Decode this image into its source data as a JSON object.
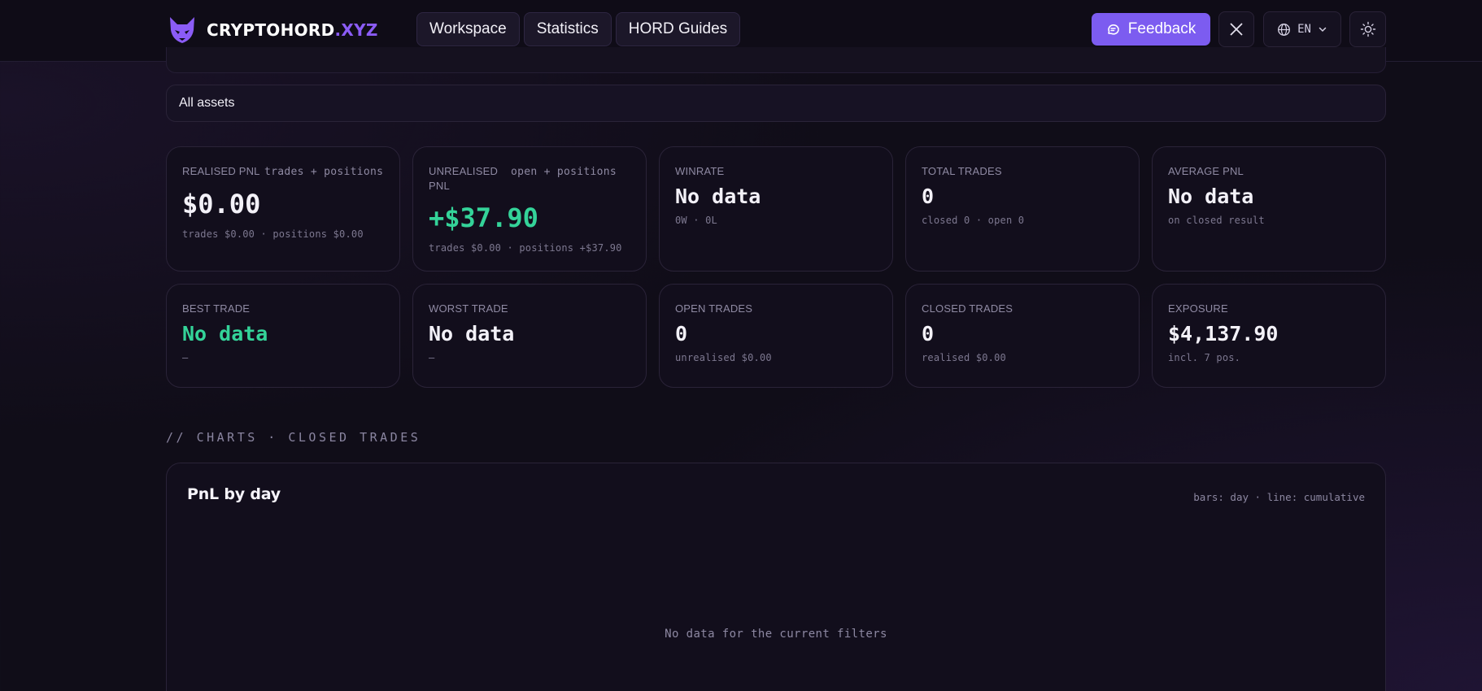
{
  "header": {
    "logo_main": "CRYPTOHORD",
    "logo_accent": ".XYZ",
    "nav": [
      {
        "label": "Workspace"
      },
      {
        "label": "Statistics"
      },
      {
        "label": "HORD Guides"
      }
    ],
    "feedback_label": "Feedback",
    "language": "EN",
    "colors": {
      "accent": "#7c5cf0",
      "positive": "#34d399"
    }
  },
  "filter": {
    "asset_label": "All assets"
  },
  "stats": {
    "realised": {
      "label": "REALISED PNL",
      "sub": "trades + positions",
      "value": "$0.00",
      "note": "trades $0.00 · positions $0.00"
    },
    "unrealised": {
      "label": "UNREALISED PNL",
      "sub": "open + positions",
      "value": "+$37.90",
      "note": "trades $0.00 · positions +$37.90"
    },
    "winrate": {
      "label": "WINRATE",
      "value": "No data",
      "note": "0W · 0L"
    },
    "total_trades": {
      "label": "TOTAL TRADES",
      "value": "0",
      "note": "closed 0 · open 0"
    },
    "average_pnl": {
      "label": "AVERAGE PNL",
      "value": "No data",
      "note": "on closed result"
    },
    "best_trade": {
      "label": "BEST TRADE",
      "value": "No data",
      "note": "—"
    },
    "worst_trade": {
      "label": "WORST TRADE",
      "value": "No data",
      "note": "—"
    },
    "open_trades": {
      "label": "OPEN TRADES",
      "value": "0",
      "note": "unrealised $0.00"
    },
    "closed_trades": {
      "label": "CLOSED TRADES",
      "value": "0",
      "note": "realised $0.00"
    },
    "exposure": {
      "label": "EXPOSURE",
      "value": "$4,137.90",
      "note": "incl. 7 pos."
    }
  },
  "charts": {
    "section_title": "// CHARTS · CLOSED TRADES",
    "pnl_by_day": {
      "title": "PnL by day",
      "legend": "bars: day · line: cumulative",
      "empty_message": "No data for the current filters"
    }
  }
}
